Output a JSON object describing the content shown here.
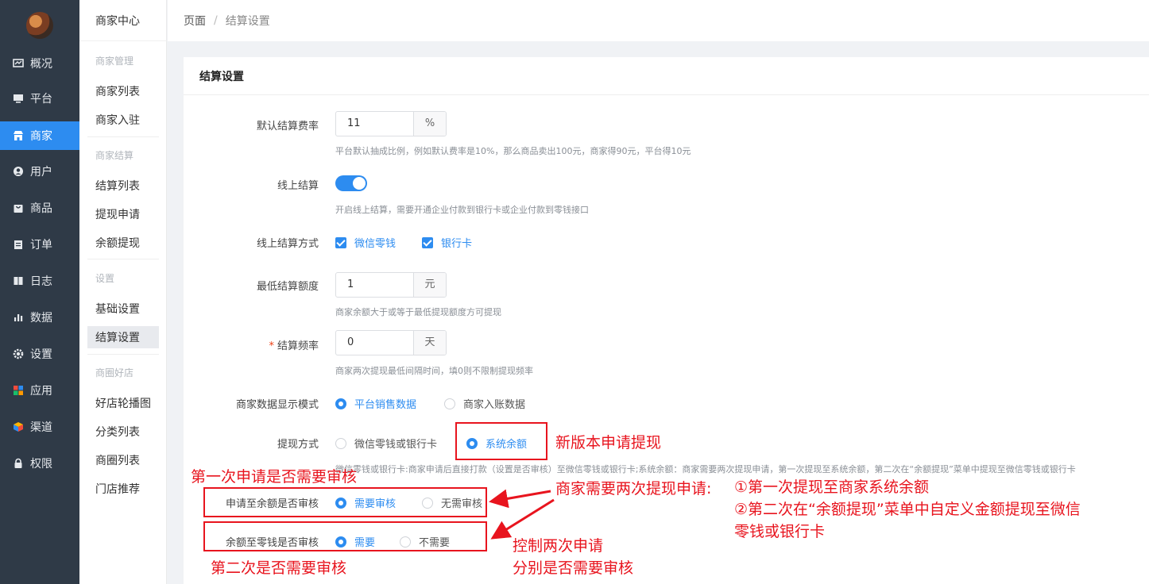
{
  "rail": {
    "items": [
      {
        "label": "概况",
        "icon": "dashboard-icon"
      },
      {
        "label": "平台",
        "icon": "monitor-icon"
      },
      {
        "label": "商家",
        "icon": "store-icon"
      },
      {
        "label": "用户",
        "icon": "user-icon"
      },
      {
        "label": "商品",
        "icon": "bag-icon"
      },
      {
        "label": "订单",
        "icon": "clipboard-icon"
      },
      {
        "label": "日志",
        "icon": "book-icon"
      },
      {
        "label": "数据",
        "icon": "bar-chart-icon"
      },
      {
        "label": "设置",
        "icon": "gear-icon"
      },
      {
        "label": "应用",
        "icon": "apps-grid-icon"
      },
      {
        "label": "渠道",
        "icon": "cube-icon"
      },
      {
        "label": "权限",
        "icon": "lock-icon"
      }
    ],
    "active": "商家"
  },
  "submenu": {
    "title": "商家中心",
    "groups": [
      {
        "title": "商家管理",
        "items": [
          "商家列表",
          "商家入驻"
        ]
      },
      {
        "title": "商家结算",
        "items": [
          "结算列表",
          "提现申请",
          "余额提现"
        ]
      },
      {
        "title": "设置",
        "items": [
          "基础设置",
          "结算设置"
        ]
      },
      {
        "title": "商圈好店",
        "items": [
          "好店轮播图",
          "分类列表",
          "商圈列表",
          "门店推荐"
        ]
      }
    ],
    "active": "结算设置"
  },
  "breadcrumb": {
    "root": "页面",
    "separator": "/",
    "current": "结算设置"
  },
  "card": {
    "title": "结算设置"
  },
  "form": {
    "rate": {
      "label": "默认结算费率",
      "value": "11",
      "unit": "%",
      "help": "平台默认抽成比例，例如默认费率是10%，那么商品卖出100元，商家得90元，平台得10元"
    },
    "online": {
      "label": "线上结算",
      "enabled": true,
      "help": "开启线上结算，需要开通企业付款到银行卡或企业付款到零钱接口"
    },
    "online_method": {
      "label": "线上结算方式",
      "options": [
        "微信零钱",
        "银行卡"
      ]
    },
    "min_amount": {
      "label": "最低结算额度",
      "value": "1",
      "unit": "元",
      "help": "商家余额大于或等于最低提现额度方可提现"
    },
    "frequency": {
      "label": "结算频率",
      "required_mark": "*",
      "value": "0",
      "unit": "天",
      "help": "商家两次提现最低间隔时间，填0则不限制提现频率"
    },
    "display_mode": {
      "label": "商家数据显示模式",
      "options": [
        "平台销售数据",
        "商家入账数据"
      ],
      "selected": 0
    },
    "withdraw_method": {
      "label": "提现方式",
      "options": [
        "微信零钱或银行卡",
        "系统余额"
      ],
      "selected": 1,
      "help": "微信零钱或银行卡:商家申请后直接打款（设置是否审核）至微信零钱或银行卡;系统余额：商家需要两次提现申请，第一次提现至系统余额，第二次在“余额提现”菜单中提现至微信零钱或银行卡"
    },
    "to_balance_review": {
      "label": "申请至余额是否审核",
      "options": [
        "需要审核",
        "无需审核"
      ],
      "selected": 0
    },
    "to_wallet_review": {
      "label": "余额至零钱是否审核",
      "options": [
        "需要",
        "不需要"
      ],
      "selected": 0
    }
  },
  "annotations": {
    "new_version": "新版本申请提现",
    "first_review": "第一次申请是否需要审核",
    "second_review": "第二次是否需要审核",
    "two_step_title": "商家需要两次提现申请:",
    "two_step_1": "①第一次提现至商家系统余额",
    "two_step_2a": "②第二次在“余额提现”菜单中自定义金额提现至微信",
    "two_step_2b": "零钱或银行卡",
    "control_a": "控制两次申请",
    "control_b": "分别是否需要审核",
    "color": "#e8141e"
  },
  "colors": {
    "primary": "#2d8cf0",
    "rail": "#2f3a47"
  }
}
